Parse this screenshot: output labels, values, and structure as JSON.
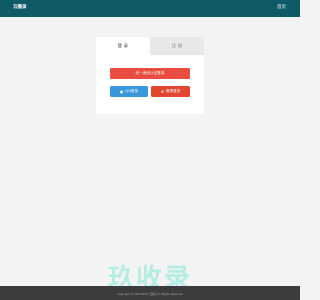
{
  "header": {
    "brand": "云圈录",
    "home_link": "首页"
  },
  "tabs": [
    {
      "label": "登 录"
    },
    {
      "label": "注 册"
    }
  ],
  "buttons": {
    "unified_login": "统一身份认证登录",
    "qq_login": "QQ登录",
    "weibo_login": "微博登录"
  },
  "icons": {
    "qq": "qq-icon",
    "weibo": "weibo-icon"
  },
  "watermark": "玖收录",
  "footer": {
    "copyright": "Copyright © 2015-2021 云圈录 All Rights Reserved"
  },
  "colors": {
    "topbar": "#0e5a67",
    "unified_button": "#e94d3f",
    "qq_button": "#3a97dd",
    "weibo_button": "#e2462f",
    "footer": "#3c3c3c"
  }
}
